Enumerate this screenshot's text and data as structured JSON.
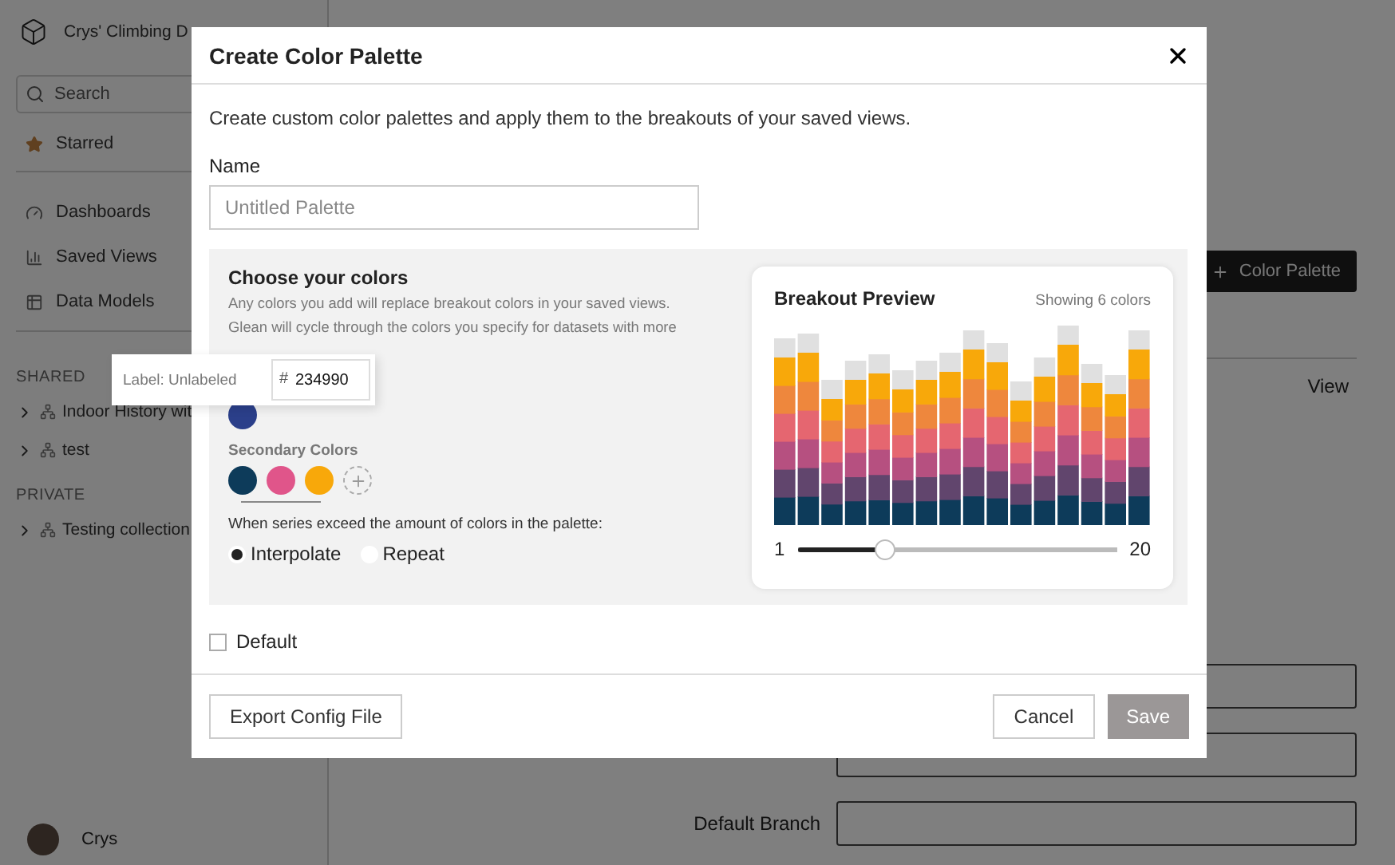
{
  "sidebar": {
    "workspace": "Crys' Climbing D",
    "search": {
      "placeholder": "Search"
    },
    "items": [
      {
        "label": "Starred",
        "kind": "star"
      },
      {
        "label": "Dashboards",
        "kind": "gauge"
      },
      {
        "label": "Saved Views",
        "kind": "bars"
      },
      {
        "label": "Data Models",
        "kind": "table"
      }
    ],
    "sections": [
      {
        "heading": "SHARED",
        "items": [
          {
            "label": "Indoor History wit",
            "expanded": false
          },
          {
            "label": "test",
            "expanded": false
          }
        ]
      },
      {
        "heading": "PRIVATE",
        "items": [
          {
            "label": "Testing collection",
            "expanded": false
          }
        ]
      }
    ],
    "user": {
      "name": "Crys"
    }
  },
  "main": {
    "action_button": "Color Palette",
    "view_label": "View",
    "form_rows": [
      {
        "kind": "input"
      },
      {
        "kind": "input"
      },
      {
        "kind": "labeled",
        "label": "Default Branch"
      }
    ]
  },
  "dialog": {
    "title": "Create Color Palette",
    "description": "Create custom color palettes and apply them to the breakouts of your saved views.",
    "name_field": {
      "label": "Name",
      "placeholder": "Untitled Palette"
    },
    "colors": {
      "heading": "Choose your colors",
      "description": "Any colors you add will replace breakout colors in your saved views. Glean will cycle through the colors you specify for datasets with more",
      "primary": {
        "color": "#2b3f8a"
      },
      "popover": {
        "label": "Label: Unlabeled",
        "hash": "#",
        "value": "234990"
      },
      "secondary": {
        "heading": "Secondary Colors",
        "swatches": [
          {
            "color": "#0d3b5a"
          },
          {
            "color": "#e0558a"
          },
          {
            "color": "#f8a80a"
          }
        ]
      },
      "overflow": {
        "prompt": "When series exceed the amount of colors in the palette:",
        "options": [
          {
            "label": "Interpolate",
            "selected": true
          },
          {
            "label": "Repeat",
            "selected": false
          }
        ]
      }
    },
    "preview": {
      "title": "Breakout Preview",
      "count": "Showing 6 colors",
      "slider": {
        "min": "1",
        "max": "20",
        "level": 0.27
      }
    },
    "default_checkbox": {
      "label": "Default",
      "checked": false
    },
    "footer": {
      "export": "Export Config File",
      "cancel": "Cancel",
      "save": {
        "label": "Save",
        "disabled": true
      }
    }
  }
}
